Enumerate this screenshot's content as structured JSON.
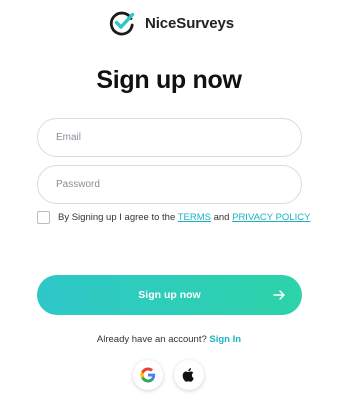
{
  "brand": {
    "name": "NiceSurveys",
    "icon": "checkmark-circle-logo",
    "accent": "#2ec7c9"
  },
  "page": {
    "title": "Sign up now"
  },
  "form": {
    "email": {
      "placeholder": "Email",
      "value": ""
    },
    "password": {
      "placeholder": "Password",
      "value": ""
    },
    "agree": {
      "checked": false,
      "prefix": "By Signing up I agree to the ",
      "terms_label": "TERMS",
      "conjunction": " and ",
      "privacy_label": "PRIVACY POLICY"
    },
    "submit": {
      "label": "Sign up now",
      "icon": "arrow-right-icon",
      "gradient": [
        "#2ec7c9",
        "#2dd3a9"
      ]
    }
  },
  "footer": {
    "account_prompt": "Already have an account? ",
    "signin_label": "Sign In",
    "social": [
      {
        "name": "google",
        "icon": "google-icon"
      },
      {
        "name": "apple",
        "icon": "apple-icon"
      }
    ]
  },
  "colors": {
    "link": "#19b4c4",
    "text": "#1a1a1a",
    "border": "#d8dbe0"
  }
}
